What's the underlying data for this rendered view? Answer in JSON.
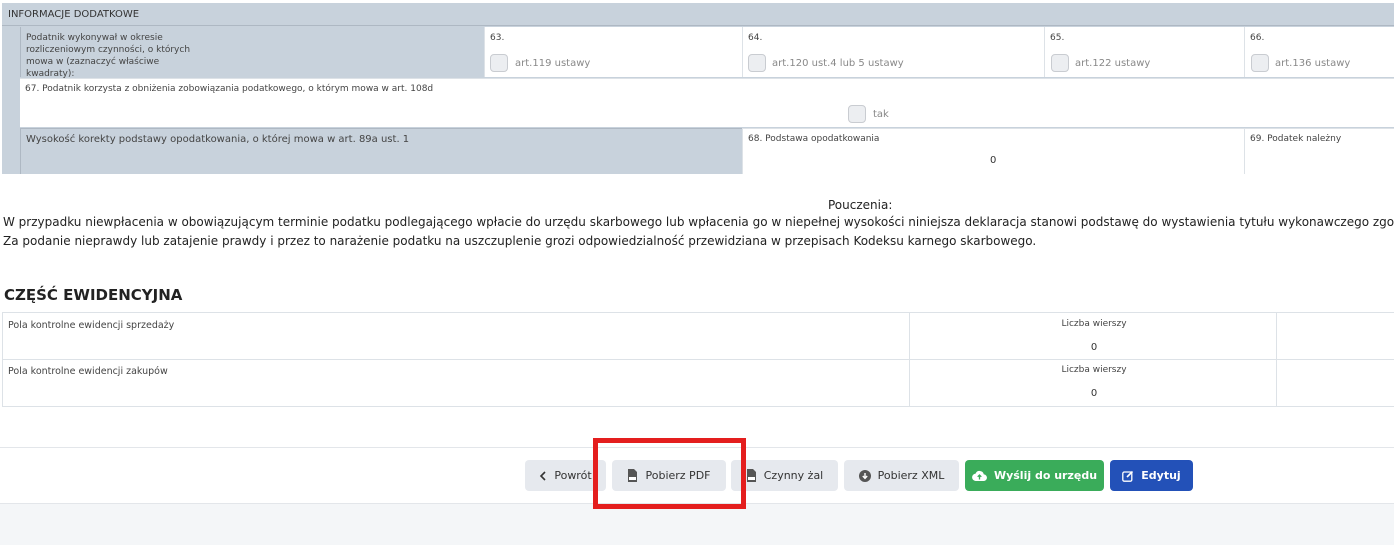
{
  "info": {
    "header": "INFORMACJE DODATKOWE",
    "row1_label": "Podatnik wykonywał w okresie rozliczeniowym czynności, o których mowa w (zaznaczyć właściwe kwadraty):",
    "row1_fields": [
      {
        "num": "63.",
        "label": "art.119 ustawy"
      },
      {
        "num": "64.",
        "label": "art.120 ust.4 lub 5 ustawy"
      },
      {
        "num": "65.",
        "label": "art.122 ustawy"
      },
      {
        "num": "66.",
        "label": "art.136 ustawy"
      }
    ],
    "row2_label": "67. Podatnik korzysta z obniżenia zobowiązania podatkowego, o którym mowa w art. 108d",
    "row2_checkbox_label": "tak",
    "row3_label": "Wysokość korekty podstawy opodatkowania, o której mowa w art. 89a ust. 1",
    "row3_field68_label": "68. Podstawa opodatkowania",
    "row3_field68_value": "0",
    "row3_field69_label": "69. Podatek należny"
  },
  "pouczenia": {
    "title": "Pouczenia:",
    "line1": "W przypadku niewpłacenia w obowiązującym terminie podatku podlegającego wpłacie do urzędu skarbowego lub wpłacenia go w niepełnej wysokości niniejsza deklaracja stanowi podstawę do wystawienia tytułu wykonawczego zgodnie z przepisami o",
    "line2": "Za podanie nieprawdy lub zatajenie prawdy i przez to narażenie podatku na uszczuplenie grozi odpowiedzialność przewidziana w przepisach Kodeksu karnego skarbowego."
  },
  "ewidencja": {
    "title": "CZĘŚĆ EWIDENCYJNA",
    "rows": [
      {
        "label": "Pola kontrolne ewidencji sprzedaży",
        "count_label": "Liczba wierszy",
        "count": "0"
      },
      {
        "label": "Pola kontrolne ewidencji zakupów",
        "count_label": "Liczba wierszy",
        "count": "0"
      }
    ]
  },
  "buttons": {
    "back": "Powrót",
    "pdf": "Pobierz PDF",
    "active_grievance": "Czynny żal",
    "xml": "Pobierz XML",
    "send": "Wyślij do urzędu",
    "edit": "Edytuj"
  },
  "colors": {
    "green": "#3aac5a",
    "blue": "#2351b8",
    "highlight": "#e41e1e"
  }
}
